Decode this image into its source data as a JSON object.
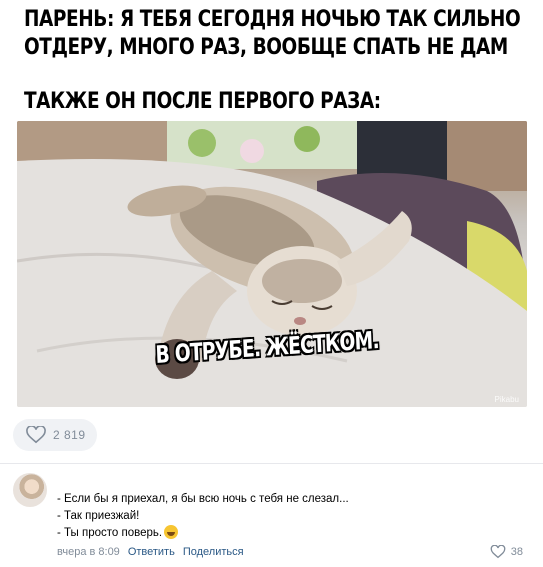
{
  "post": {
    "headline": "ПАРЕНЬ: Я ТЕБЯ СЕГОДНЯ НОЧЬЮ ТАК СИЛЬНО ОТДЕРУ, МНОГО РАЗ, ВООБЩЕ СПАТЬ НЕ ДАМ",
    "headline_line1": "ПАРЕНЬ: Я ТЕБЯ СЕГОДНЯ НОЧЬЮ ТАК СИЛЬНО",
    "headline_line2": "ОТДЕРУ, МНОГО РАЗ, ВООБЩЕ СПАТЬ НЕ ДАМ",
    "subheadline": "ТАКЖЕ ОН ПОСЛЕ ПЕРВОГО РАЗА:",
    "image_caption": "В ОТРУБЕ. ЖЁСТКОМ.",
    "watermark": "Pikabu",
    "like_count": "2 819",
    "like_icon": "heart-icon"
  },
  "comment": {
    "lines": [
      "- Если бы я приехал, я бы всю ночь с тебя не слезал...",
      "- Так приезжай!",
      "- Ты просто поверь."
    ],
    "emoji": "rolling-laughing-emoji",
    "time": "вчера в 8:09",
    "reply_label": "Ответить",
    "share_label": "Поделиться",
    "like_count": "38",
    "like_icon": "heart-icon"
  },
  "colors": {
    "link": "#2a5885",
    "muted": "#818c99",
    "pill_bg": "#f0f2f5"
  }
}
